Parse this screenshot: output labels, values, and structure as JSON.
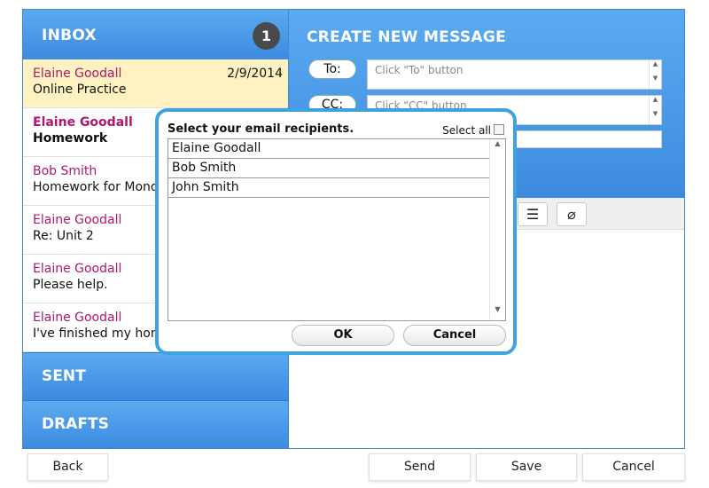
{
  "inbox": {
    "title": "INBOX",
    "unread_count": "1",
    "messages": [
      {
        "sender": "Elaine Goodall",
        "subject": "Online Practice",
        "date": "2/9/2014",
        "selected": true,
        "unread": false
      },
      {
        "sender": "Elaine Goodall",
        "subject": "Homework",
        "unread": true
      },
      {
        "sender": "Bob Smith",
        "subject": "Homework for Monday",
        "unread": false
      },
      {
        "sender": "Elaine Goodall",
        "subject": "Re: Unit 2",
        "unread": false
      },
      {
        "sender": "Elaine Goodall",
        "subject": "Please help.",
        "unread": false
      },
      {
        "sender": "Elaine Goodall",
        "subject": "I've finished my homework",
        "unread": false
      }
    ]
  },
  "folders": {
    "sent": "SENT",
    "drafts": "DRAFTS"
  },
  "compose": {
    "title": "CREATE NEW MESSAGE",
    "to_label": "To:",
    "to_placeholder": "Click \"To\" button",
    "cc_label": "CC:",
    "cc_placeholder": "Click \"CC\" button"
  },
  "modal": {
    "title": "Select your email recipients.",
    "select_all_label": "Select all",
    "recipients": [
      "Elaine Goodall",
      "Bob Smith",
      "John Smith"
    ],
    "ok_label": "OK",
    "cancel_label": "Cancel"
  },
  "bottom": {
    "back_label": "Back",
    "send_label": "Send",
    "save_label": "Save",
    "cancel_label": "Cancel"
  },
  "colors": {
    "header_blue": "#4a9be8",
    "sender_magenta": "#b0176d",
    "selected_row": "#fdf2c0",
    "modal_border": "#3fa2df"
  }
}
